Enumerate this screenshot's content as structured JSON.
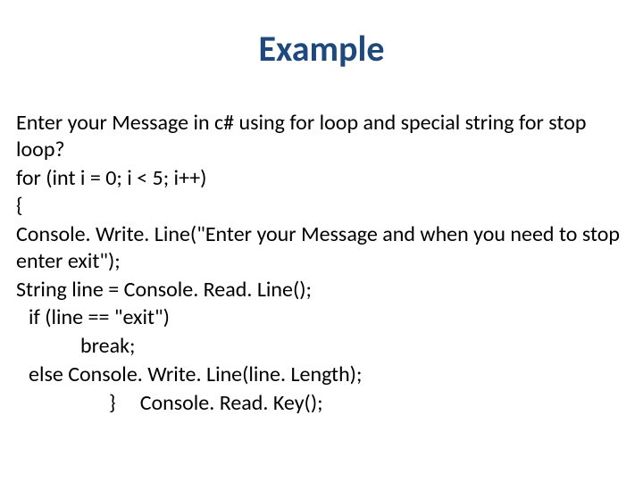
{
  "title": "Example",
  "lines": {
    "l0": "Enter your Message in c#  using for loop and  special string for stop loop?",
    "l1": "for (int i = 0; i < 5; i++)",
    "l2": "{",
    "l3": "Console. Write. Line(\"Enter your Message and when you need to stop enter  exit\");",
    "l4": "String line = Console. Read. Line();",
    "l5": "if (line == \"exit\")",
    "l6": "break;",
    "l7": "else Console. Write. Line(line. Length);",
    "l8a": "}",
    "l8b": "Console. Read. Key();"
  }
}
